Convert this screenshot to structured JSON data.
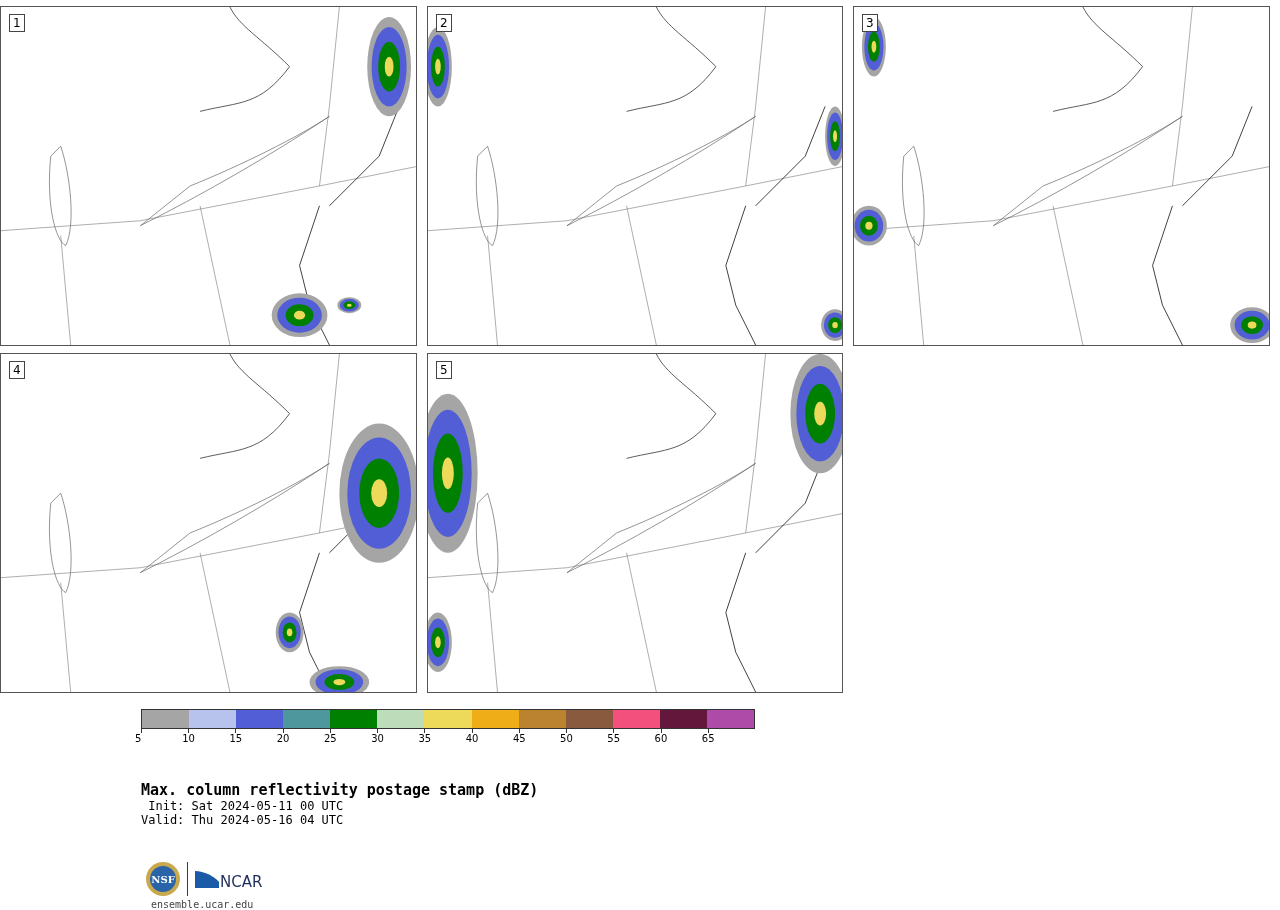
{
  "panels": [
    {
      "label": "1"
    },
    {
      "label": "2"
    },
    {
      "label": "3"
    },
    {
      "label": "4"
    },
    {
      "label": "5"
    }
  ],
  "colorbar": {
    "bins": [
      {
        "color": "#a5a5a5"
      },
      {
        "color": "#b7c2ed"
      },
      {
        "color": "#525ed6"
      },
      {
        "color": "#4e979c"
      },
      {
        "color": "#008000"
      },
      {
        "color": "#bcdcba"
      },
      {
        "color": "#eeda5a"
      },
      {
        "color": "#efad18"
      },
      {
        "color": "#bb8230"
      },
      {
        "color": "#8a5a3e"
      },
      {
        "color": "#f4507e"
      },
      {
        "color": "#63173a"
      },
      {
        "color": "#ae4ba8"
      }
    ],
    "ticks": [
      "5",
      "10",
      "15",
      "20",
      "25",
      "30",
      "35",
      "40",
      "45",
      "50",
      "55",
      "60",
      "65"
    ]
  },
  "title": "Max. column reflectivity postage stamp (dBZ)",
  "init": " Init: Sat 2024-05-11 00 UTC",
  "valid": "Valid: Thu 2024-05-16 04 UTC",
  "logos": {
    "nsf": "NSF",
    "ncar": "NCAR"
  },
  "site": "ensemble.ucar.edu"
}
